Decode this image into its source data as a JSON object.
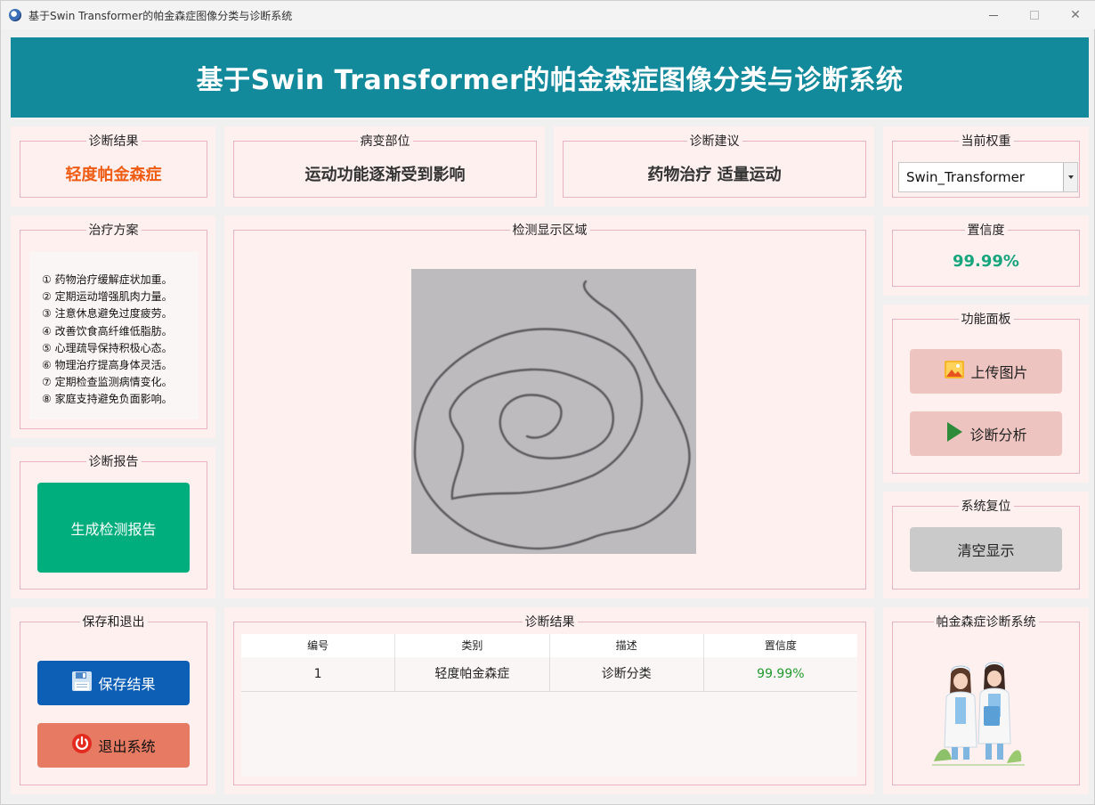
{
  "window": {
    "title": "基于Swin Transformer的帕金森症图像分类与诊断系统"
  },
  "header": {
    "title": "基于Swin Transformer的帕金森症图像分类与诊断系统"
  },
  "result_box": {
    "title": "诊断结果",
    "value": "轻度帕金森症",
    "color": "#ef5b12"
  },
  "lesion_box": {
    "title": "病变部位",
    "value": "运动功能逐渐受到影响"
  },
  "advice_box": {
    "title": "诊断建议",
    "value": "药物治疗 适量运动"
  },
  "weight_box": {
    "title": "当前权重",
    "selected": "Swin_Transformer"
  },
  "treatment": {
    "title": "治疗方案",
    "items": [
      "① 药物治疗缓解症状加重。",
      "② 定期运动增强肌肉力量。",
      "③ 注意休息避免过度疲劳。",
      "④ 改善饮食高纤维低脂肪。",
      "⑤ 心理疏导保持积极心态。",
      "⑥ 物理治疗提高身体灵活。",
      "⑦ 定期检查监测病情变化。",
      "⑧ 家庭支持避免负面影响。"
    ]
  },
  "detect": {
    "title": "检测显示区域"
  },
  "confidence_box": {
    "title": "置信度",
    "value": "99.99%",
    "color": "#16a57c"
  },
  "function_panel": {
    "title": "功能面板",
    "upload_label": "上传图片",
    "analyze_label": "诊断分析",
    "icons": [
      "image-icon",
      "play-icon"
    ]
  },
  "report": {
    "title": "诊断报告",
    "button_label": "生成检测报告",
    "color": "#00ad7c"
  },
  "reset": {
    "title": "系统复位",
    "button_label": "清空显示"
  },
  "save_exit": {
    "title": "保存和退出",
    "save_label": "保存结果",
    "exit_label": "退出系统",
    "save_color": "#0d5fb5",
    "exit_color": "#e67a62"
  },
  "results_table": {
    "title": "诊断结果",
    "columns": [
      "编号",
      "类别",
      "描述",
      "置信度"
    ],
    "rows": [
      [
        "1",
        "轻度帕金森症",
        "诊断分类",
        "99.99%"
      ]
    ]
  },
  "brand": {
    "title": "帕金森症诊断系统"
  }
}
